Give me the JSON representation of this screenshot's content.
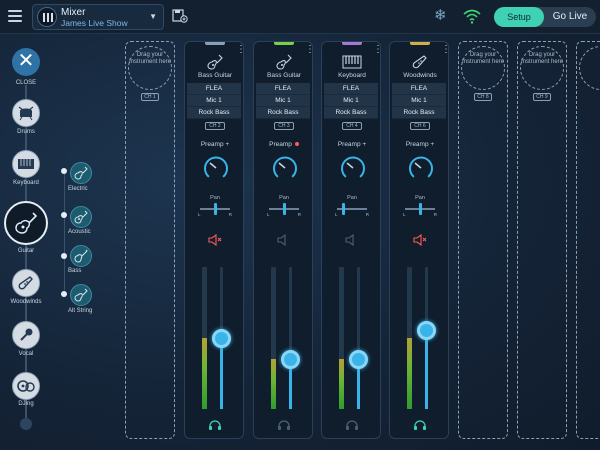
{
  "header": {
    "title": "Mixer",
    "subtitle": "James Live Show",
    "setup_label": "Setup",
    "go_live_label": "Go Live",
    "accent": "#3fd1b3"
  },
  "sidebar": {
    "close_label": "CLOSE",
    "categories": [
      {
        "label": "Drums",
        "icon": "drum-icon"
      },
      {
        "label": "Keyboard",
        "icon": "keyboard-icon"
      },
      {
        "label": "Guitar",
        "icon": "guitar-icon",
        "selected": true
      },
      {
        "label": "Woodwinds",
        "icon": "woodwind-icon"
      },
      {
        "label": "Vocal",
        "icon": "microphone-icon"
      },
      {
        "label": "DJing",
        "icon": "dj-icon"
      }
    ],
    "guitar_types": [
      {
        "label": "Electric"
      },
      {
        "label": "Acoustic"
      },
      {
        "label": "Bass"
      },
      {
        "label": "Alt String"
      }
    ]
  },
  "empty_slot": {
    "drag_text": "Drag your Instrument here"
  },
  "empty_slots": [
    {
      "channel": "CH 1"
    },
    {
      "channel": "CH 8"
    },
    {
      "channel": "CH 9"
    },
    {
      "channel": ""
    }
  ],
  "channels": [
    {
      "name": "Bass Guitar",
      "icon": "guitar-icon",
      "channel": "CH 2",
      "rows": [
        "FLEA",
        "Mic 1",
        "Rock Bass"
      ],
      "preamp": "Preamp +",
      "pan_label": "Pan",
      "pan_l": "L",
      "pan_r": "R",
      "pan": 0.5,
      "muted": true,
      "meter_level": 0.5,
      "fader_level": 0.5,
      "headphones": true,
      "accent": "#8aa0b6"
    },
    {
      "name": "Bass Guitar",
      "icon": "guitar-icon",
      "channel": "CH 3",
      "rows": [
        "FLEA",
        "Mic 1",
        "Rock Bass"
      ],
      "preamp": "Preamp",
      "pan_label": "Pan",
      "pan_l": "L",
      "pan_r": "R",
      "pan": 0.5,
      "muted": false,
      "meter_level": 0.35,
      "fader_level": 0.35,
      "headphones": false,
      "accent": "#7ad04a"
    },
    {
      "name": "Keyboard",
      "icon": "keyboard-icon",
      "channel": "CH 4",
      "rows": [
        "FLEA",
        "Mic 1",
        "Rock Bass"
      ],
      "preamp": "Preamp +",
      "pan_label": "Pan",
      "pan_l": "L",
      "pan_r": "R",
      "pan": 0.2,
      "muted": false,
      "meter_level": 0.35,
      "fader_level": 0.35,
      "headphones": false,
      "accent": "#a57ad0"
    },
    {
      "name": "Woodwinds",
      "icon": "woodwind-icon",
      "channel": "CH 6",
      "rows": [
        "FLEA",
        "Mic 1",
        "Rock Bass"
      ],
      "preamp": "Preamp +",
      "pan_label": "Pan",
      "pan_l": "L",
      "pan_r": "R",
      "pan": 0.5,
      "muted": true,
      "meter_level": 0.5,
      "fader_level": 0.55,
      "headphones": true,
      "accent": "#d0b04a"
    }
  ]
}
